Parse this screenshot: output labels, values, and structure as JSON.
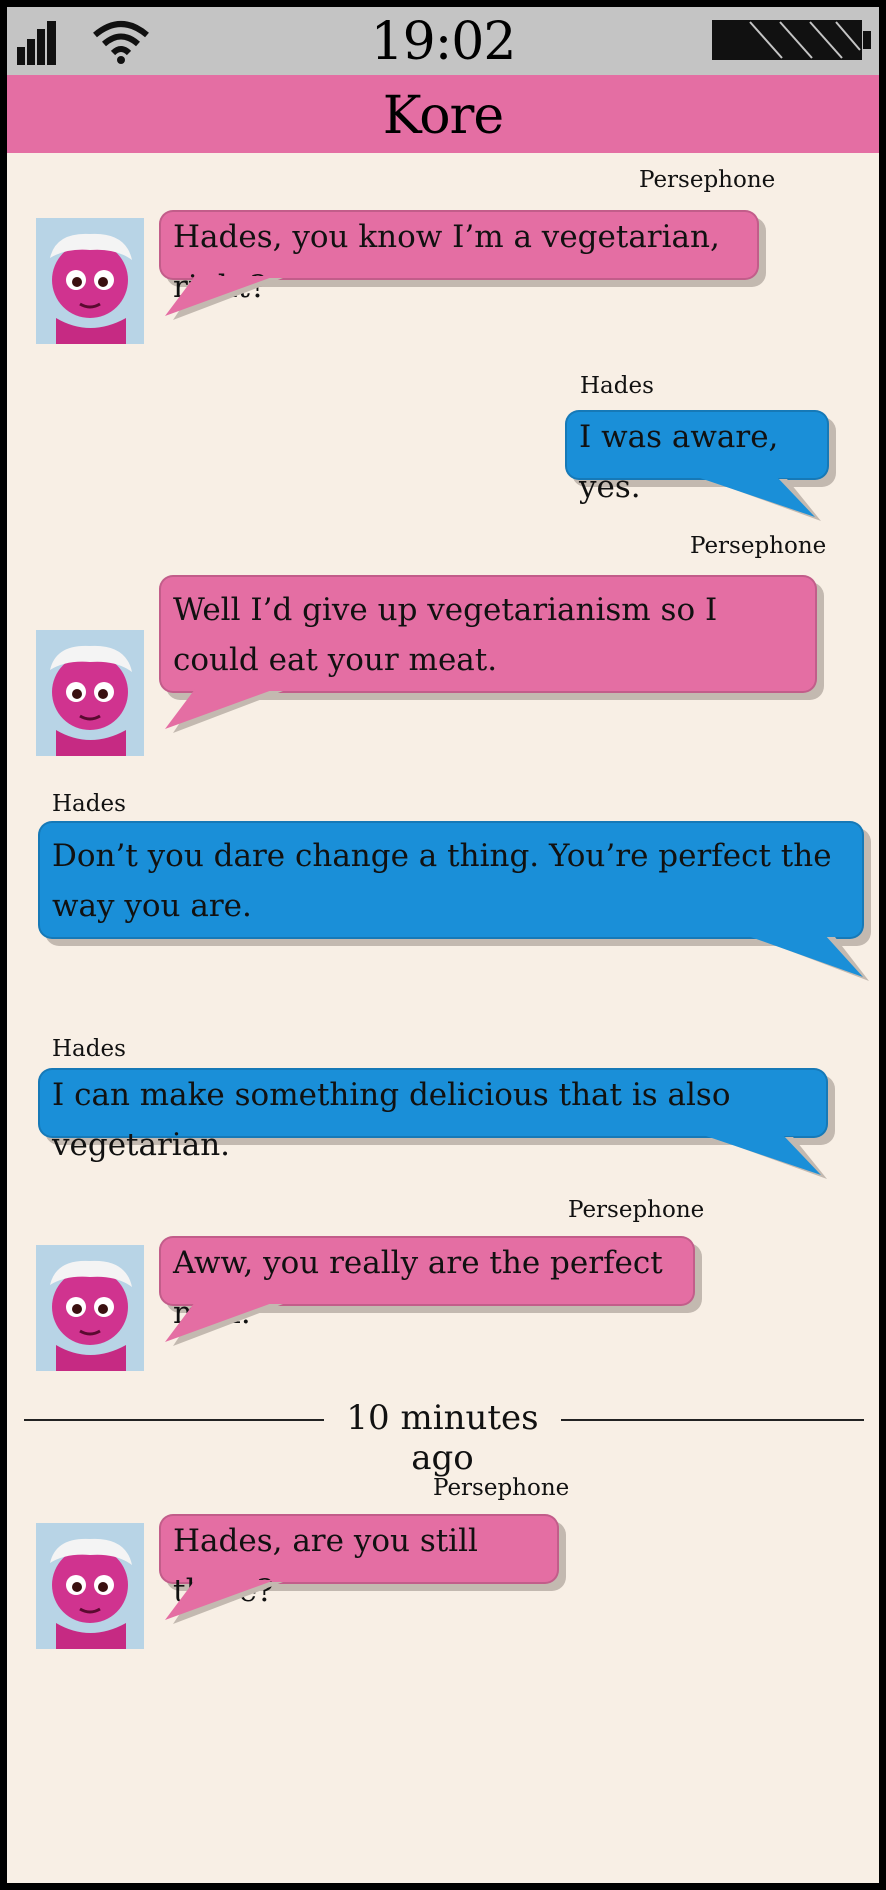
{
  "status_bar": {
    "time": "19:02",
    "icons": [
      "signal-icon",
      "wifi-icon",
      "battery-icon"
    ]
  },
  "header": {
    "title": "Kore"
  },
  "messages": [
    {
      "sender": "Persephone",
      "text": "Hades, you know I’m a vegetarian, right?",
      "side": "left",
      "color": "#e46ea3"
    },
    {
      "sender": "Hades",
      "text": "I was aware, yes.",
      "side": "right",
      "color": "#1a8fd8"
    },
    {
      "sender": "Persephone",
      "text": "Well I’d give up vegetarianism so I could eat your meat.",
      "side": "left",
      "color": "#e46ea3"
    },
    {
      "sender": "Hades",
      "text": "Don’t you dare change a thing. You’re perfect the way you are.",
      "side": "right",
      "color": "#1a8fd8"
    },
    {
      "sender": "Hades",
      "text": "I can make something delicious that is also vegetarian.",
      "side": "right",
      "color": "#1a8fd8"
    },
    {
      "sender": "Persephone",
      "text": "Aww, you really are the perfect man.",
      "side": "left",
      "color": "#e46ea3"
    },
    {
      "sender": "Persephone",
      "text": "Hades, are you still there?",
      "side": "left",
      "color": "#e46ea3"
    }
  ],
  "divider": {
    "text": "10 minutes ago"
  },
  "colors": {
    "header": "#e46ea3",
    "status_bar": "#c4c4c4",
    "background": "#f8efe5",
    "persephone_bubble": "#e46ea3",
    "hades_bubble": "#1a8fd8"
  }
}
